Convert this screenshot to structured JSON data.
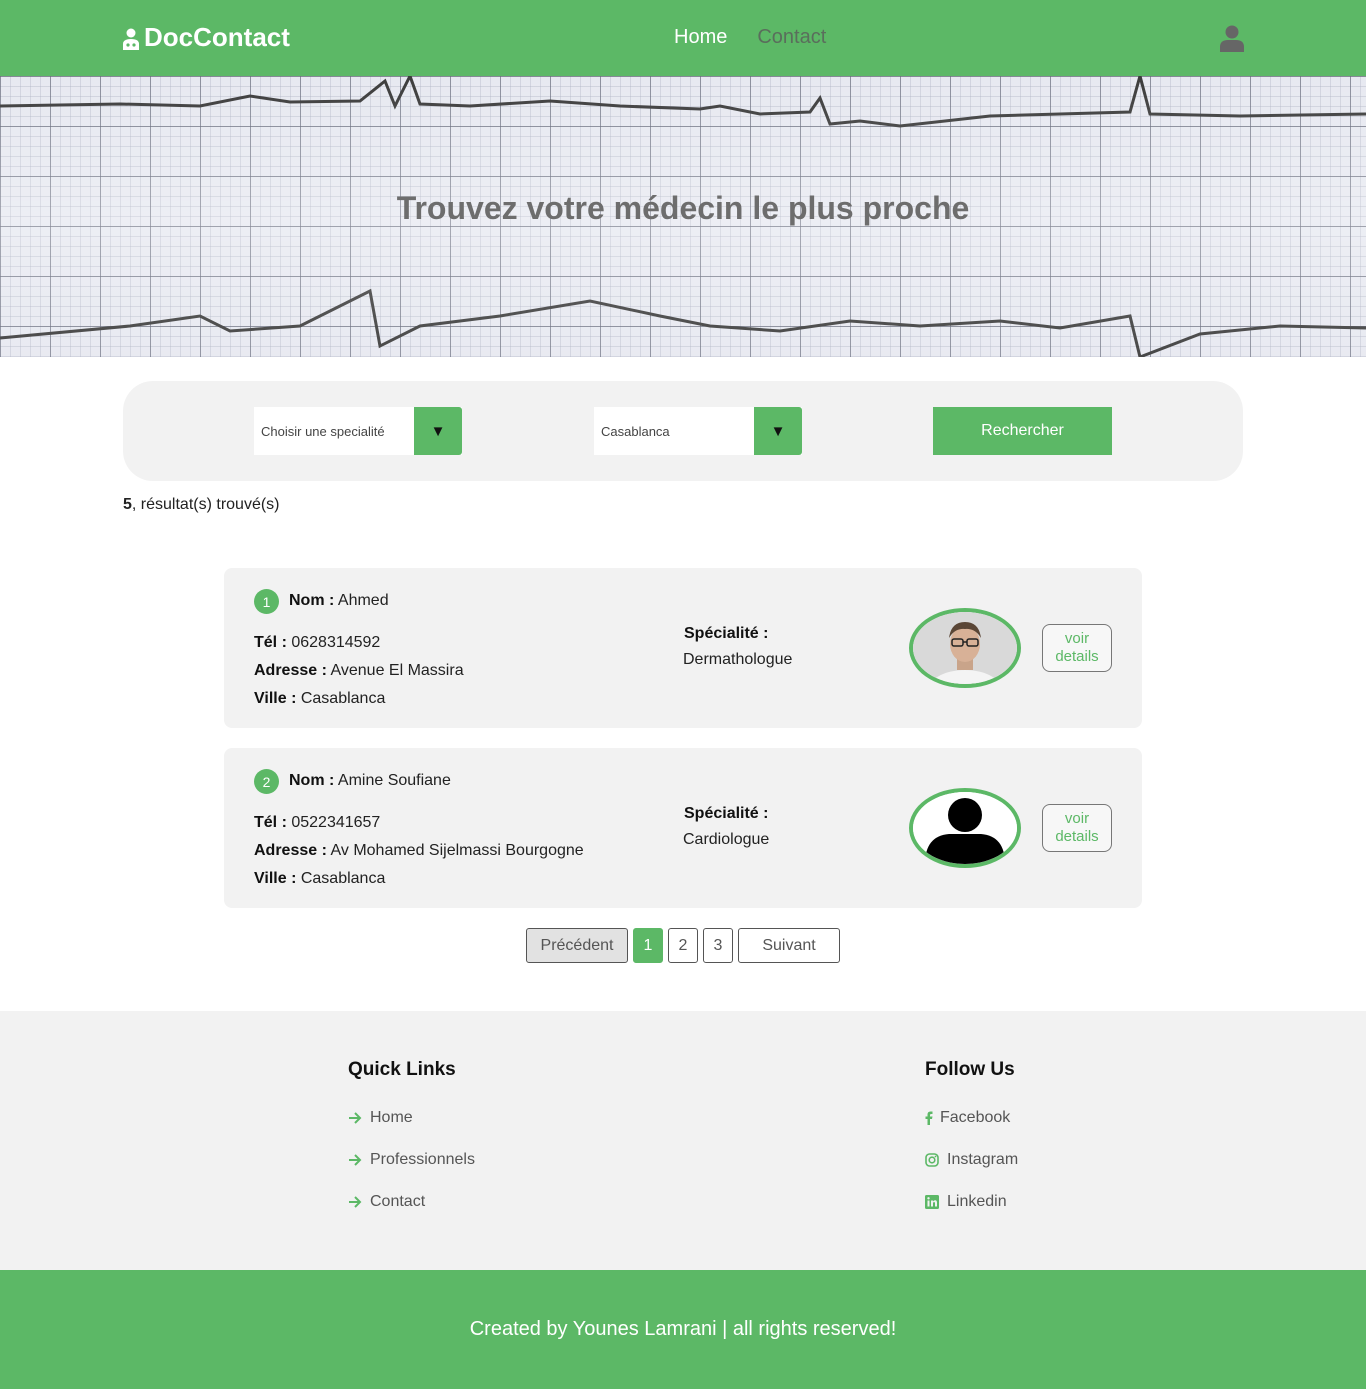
{
  "navbar": {
    "brand": "DocContact",
    "links": [
      "Home",
      "Contact"
    ]
  },
  "hero": {
    "title": "Trouvez votre médecin le plus proche"
  },
  "search": {
    "speciality_value": "Choisir une specialité",
    "city_value": "Casablanca",
    "button_label": "Rechercher"
  },
  "results": {
    "count": "5",
    "label": ", résultat(s) trouvé(s)"
  },
  "labels": {
    "nom": "Nom :",
    "tel": "Tél :",
    "adresse": "Adresse :",
    "ville": "Ville :",
    "specialite": "Spécialité :",
    "details": "voir details"
  },
  "doctors": [
    {
      "index": "1",
      "nom": "Ahmed",
      "tel": "0628314592",
      "adresse": "Avenue El Massira",
      "ville": "Casablanca",
      "specialite": "Dermathologue",
      "avatar": "photo-avatar"
    },
    {
      "index": "2",
      "nom": "Amine Soufiane",
      "tel": "0522341657",
      "adresse": "Av Mohamed Sijelmassi Bourgogne",
      "ville": "Casablanca",
      "specialite": "Cardiologue",
      "avatar": "silhouette-avatar"
    }
  ],
  "pagination": {
    "prev": "Précédent",
    "pages": [
      "1",
      "2",
      "3"
    ],
    "current": "1",
    "next": "Suivant"
  },
  "footer": {
    "quick_links_title": "Quick Links",
    "quick_links": [
      "Home",
      "Professionnels",
      "Contact"
    ],
    "follow_title": "Follow Us",
    "social": [
      "Facebook",
      "Instagram",
      "Linkedin"
    ],
    "copyright": "Created by Younes Lamrani | all rights reserved!"
  },
  "colors": {
    "accent": "#5cb866",
    "panel": "#f2f2f2"
  }
}
